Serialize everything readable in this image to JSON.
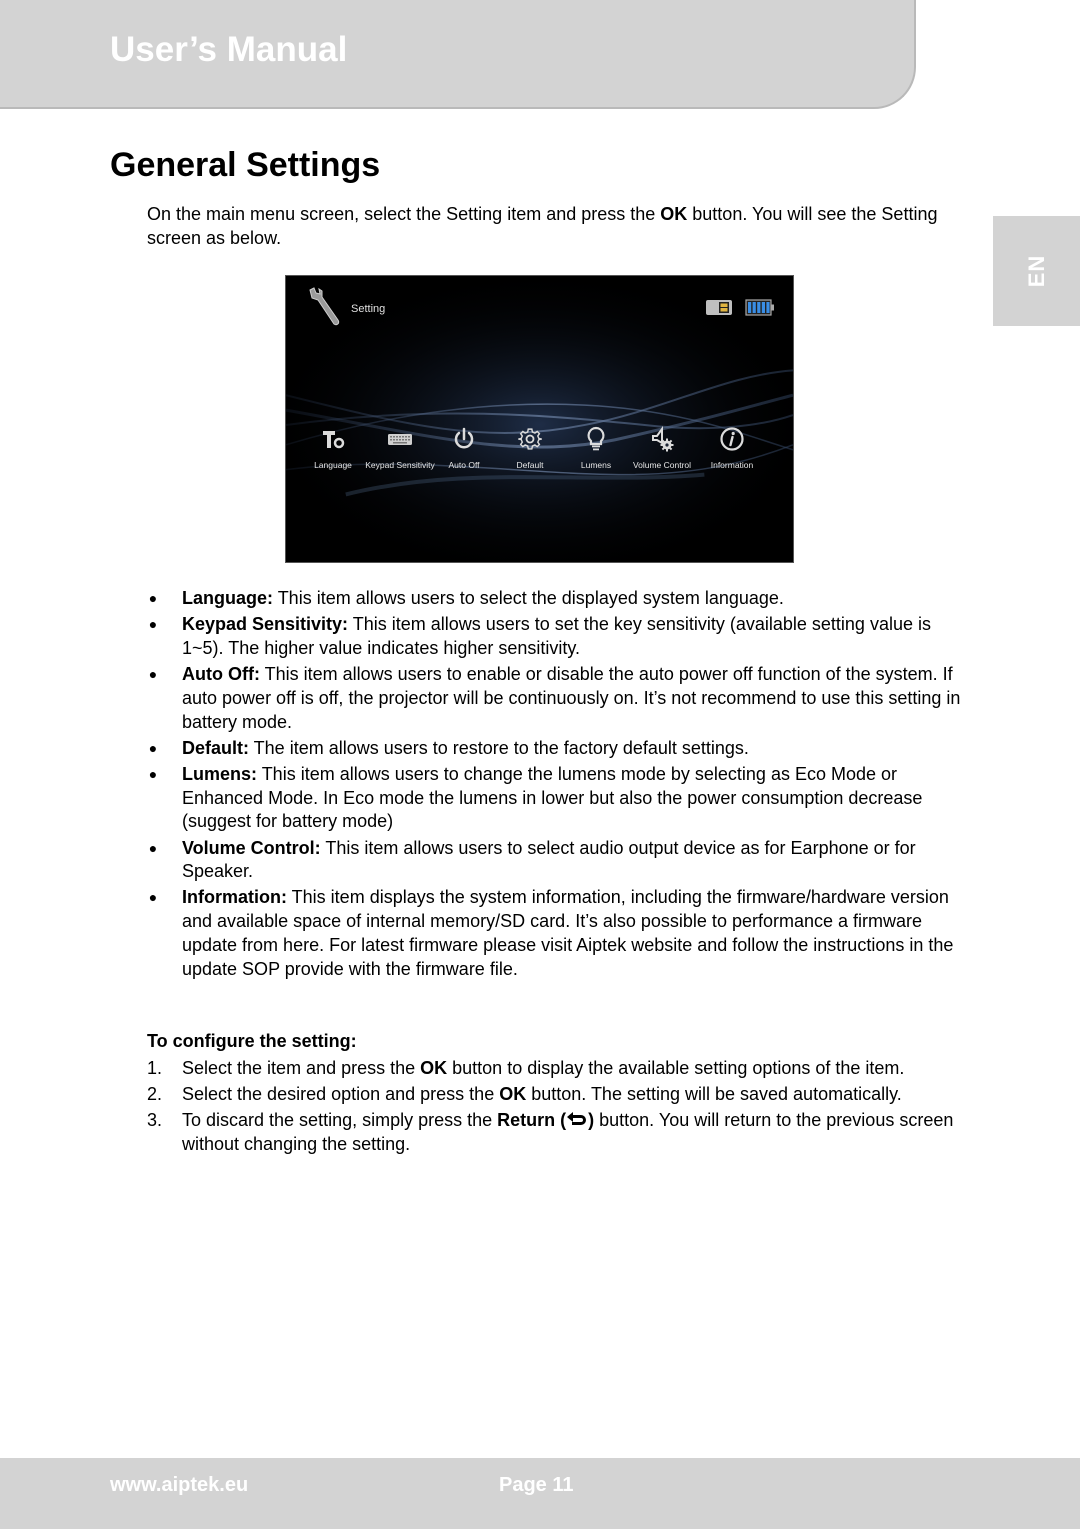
{
  "header": {
    "title": "User’s Manual",
    "language_tab": "EN"
  },
  "page_title": "General Settings",
  "intro": {
    "part1": "On the main menu screen, select the Setting item and press the ",
    "bold": "OK",
    "part2": " button. You will see the Setting screen as below."
  },
  "screenshot": {
    "title": "Setting",
    "title_icon": "wrench-icon",
    "status_icons": [
      "sd-card-icon",
      "battery-full-icon"
    ],
    "menu_items": [
      {
        "label": "Language",
        "icon": "language-text-icon"
      },
      {
        "label": "Keypad Sensitivity",
        "icon": "keyboard-icon"
      },
      {
        "label": "Auto Off",
        "icon": "power-icon"
      },
      {
        "label": "Default",
        "icon": "gear-icon"
      },
      {
        "label": "Lumens",
        "icon": "lightbulb-icon"
      },
      {
        "label": "Volume Control",
        "icon": "speaker-gear-icon"
      },
      {
        "label": "Information",
        "icon": "info-icon"
      }
    ]
  },
  "bullets": [
    {
      "term": "Language:",
      "text": " This item allows users to select the displayed system language."
    },
    {
      "term": "Keypad Sensitivity:",
      "text": " This item allows users to set the key sensitivity (available setting value is 1~5). The higher value indicates higher sensitivity."
    },
    {
      "term": "Auto Off:",
      "text": " This item allows users to enable or disable the auto power off function of the system. If auto power off is off, the projector will be continuously on. It’s not recommend to use this setting in battery mode."
    },
    {
      "term": "Default:",
      "text": " The item allows users to restore to the factory default settings."
    },
    {
      "term": "Lumens:",
      "text": " This item allows users to change the lumens mode by selecting as Eco Mode or Enhanced Mode. In Eco mode the lumens in lower but also the power consumption decrease (suggest for battery mode)"
    },
    {
      "term": "Volume Control:",
      "text": " This item allows users to select audio output device as for Earphone or for Speaker."
    },
    {
      "term": "Information:",
      "text": " This item displays the system information, including the firmware/hardware version and available space of internal memory/SD card. It’s also possible to performance a firmware update from here. For latest firmware please visit Aiptek website and follow the instructions in the update SOP provide with the firmware file."
    }
  ],
  "configure": {
    "heading": "To configure the setting:",
    "steps": [
      {
        "num": "1.",
        "pre": "Select the item and press the ",
        "bold": "OK",
        "post": " button to display the available setting options of the item."
      },
      {
        "num": "2.",
        "pre": "Select the desired option and press the ",
        "bold": "OK",
        "post": " button. The setting will be saved automatically."
      },
      {
        "num": "3.",
        "pre": "To discard the setting, simply press the ",
        "bold": "Return (",
        "bold_after_icon": ")",
        "icon": "return-arrow-icon",
        "post": " button. You will return to the previous screen without changing the setting."
      }
    ]
  },
  "footer": {
    "url": "www.aiptek.eu",
    "page": "Page 11"
  },
  "colors": {
    "band_gray": "#d3d3d3",
    "band_text": "#ffffff",
    "screen_bg": "#000000"
  }
}
